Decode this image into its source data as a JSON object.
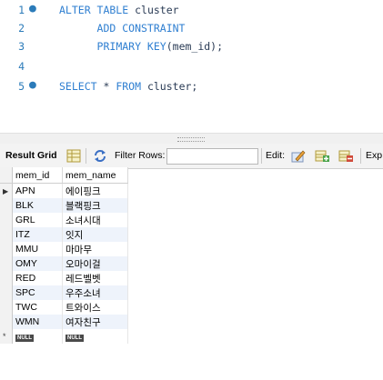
{
  "editor": {
    "lines": [
      {
        "num": "1",
        "dot": true,
        "parts": [
          [
            "kw",
            "ALTER TABLE "
          ],
          [
            "id",
            "cluster"
          ]
        ]
      },
      {
        "num": "2",
        "dot": false,
        "parts": [
          [
            "id",
            "      "
          ],
          [
            "kw",
            "ADD CONSTRAINT"
          ]
        ]
      },
      {
        "num": "3",
        "dot": false,
        "parts": [
          [
            "id",
            "      "
          ],
          [
            "kw",
            "PRIMARY KEY"
          ],
          [
            "id",
            "(mem_id);"
          ]
        ]
      },
      {
        "num": "4",
        "dot": false,
        "parts": []
      },
      {
        "num": "5",
        "dot": true,
        "parts": [
          [
            "kw",
            "SELECT "
          ],
          [
            "id",
            "* "
          ],
          [
            "kw",
            "FROM "
          ],
          [
            "id",
            "cluster;"
          ]
        ]
      }
    ]
  },
  "toolbar": {
    "result_grid_label": "Result Grid",
    "filter_rows_label": "Filter Rows:",
    "filter_value": "",
    "edit_label": "Edit:",
    "export_label": "Exp",
    "icons": [
      "grid-view-icon",
      "refresh-icon",
      "edit-row-icon",
      "add-row-icon",
      "delete-row-icon"
    ]
  },
  "grid": {
    "columns": [
      "mem_id",
      "mem_name"
    ],
    "rows": [
      [
        "APN",
        "에이핑크"
      ],
      [
        "BLK",
        "블랙핑크"
      ],
      [
        "GRL",
        "소녀시대"
      ],
      [
        "ITZ",
        "잇지"
      ],
      [
        "MMU",
        "마마무"
      ],
      [
        "OMY",
        "오마이걸"
      ],
      [
        "RED",
        "레드벨벳"
      ],
      [
        "SPC",
        "우주소녀"
      ],
      [
        "TWC",
        "트와이스"
      ],
      [
        "WMN",
        "여자친구"
      ]
    ],
    "null_label": "NULL",
    "new_row_marker": "*",
    "current_row_marker": "▶"
  }
}
